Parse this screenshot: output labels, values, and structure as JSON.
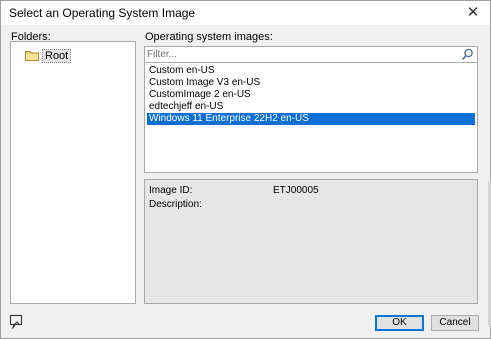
{
  "window": {
    "title": "Select an Operating System Image"
  },
  "folders": {
    "label": "Folders:",
    "items": [
      {
        "label": "Root",
        "icon": "folder-icon"
      }
    ]
  },
  "images": {
    "label": "Operating system images:",
    "filter_placeholder": "Filter...",
    "items": [
      {
        "label": "Custom  en-US",
        "selected": false
      },
      {
        "label": "Custom Image V3 en-US",
        "selected": false
      },
      {
        "label": "CustomImage 2 en-US",
        "selected": false
      },
      {
        "label": "edtechjeff  en-US",
        "selected": false
      },
      {
        "label": "Windows 11 Enterprise 22H2 en-US",
        "selected": true
      }
    ]
  },
  "details": {
    "image_id_label": "Image ID:",
    "image_id_value": "ETJ00005",
    "description_label": "Description:"
  },
  "buttons": {
    "ok": "OK",
    "cancel": "Cancel"
  },
  "colors": {
    "selection": "#0a6fd6",
    "dialog_bg": "#f0f0f0",
    "default_button_border": "#0078d7"
  }
}
